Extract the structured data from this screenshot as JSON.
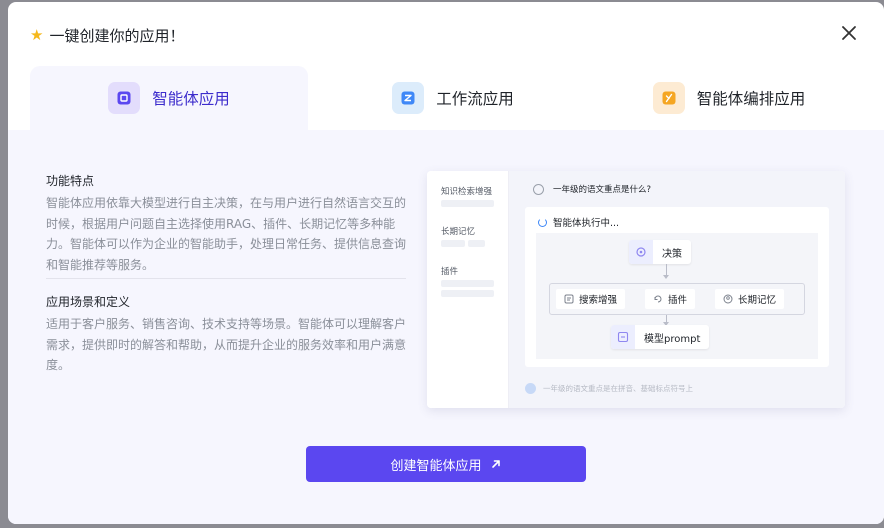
{
  "dialog": {
    "title": "一键创建你的应用！",
    "title_icon": "star-icon",
    "close_icon": "close-icon"
  },
  "tabs": [
    {
      "label": "智能体应用",
      "icon": "agent-app-icon",
      "active": true,
      "icon_color": "#5b47f0"
    },
    {
      "label": "工作流应用",
      "icon": "workflow-app-icon",
      "active": false,
      "icon_color": "#3f88f7"
    },
    {
      "label": "智能体编排应用",
      "icon": "agent-orchestration-icon",
      "active": false,
      "icon_color": "#f5a623"
    }
  ],
  "features": {
    "title": "功能特点",
    "body": "智能体应用依靠大模型进行自主决策，在与用户进行自然语言交互的时候，根据用户问题自主选择使用RAG、插件、长期记忆等多种能力。智能体可以作为企业的智能助手，处理日常任务、提供信息查询和智能推荐等服务。"
  },
  "scenarios": {
    "title": "应用场景和定义",
    "body": "适用于客户服务、销售咨询、技术支持等场景。智能体可以理解客户需求，提供即时的解答和帮助，从而提升企业的服务效率和用户满意度。"
  },
  "preview": {
    "sidebar": [
      "知识检索增强",
      "长期记忆",
      "插件"
    ],
    "question": "一年级的语文重点是什么?",
    "status": "智能体执行中...",
    "nodes": {
      "decision": "决策",
      "search": "搜索增强",
      "plugin": "插件",
      "memory": "长期记忆",
      "model": "模型prompt"
    },
    "input_hint": "一年级的语文重点是在拼音、基础标点符号上"
  },
  "create_button": {
    "label": "创建智能体应用",
    "icon": "arrow-up-right-icon"
  },
  "colors": {
    "accent": "#5b47f0",
    "panel_bg": "#f6f6fe",
    "active_tab_text": "#3c2ccc"
  }
}
